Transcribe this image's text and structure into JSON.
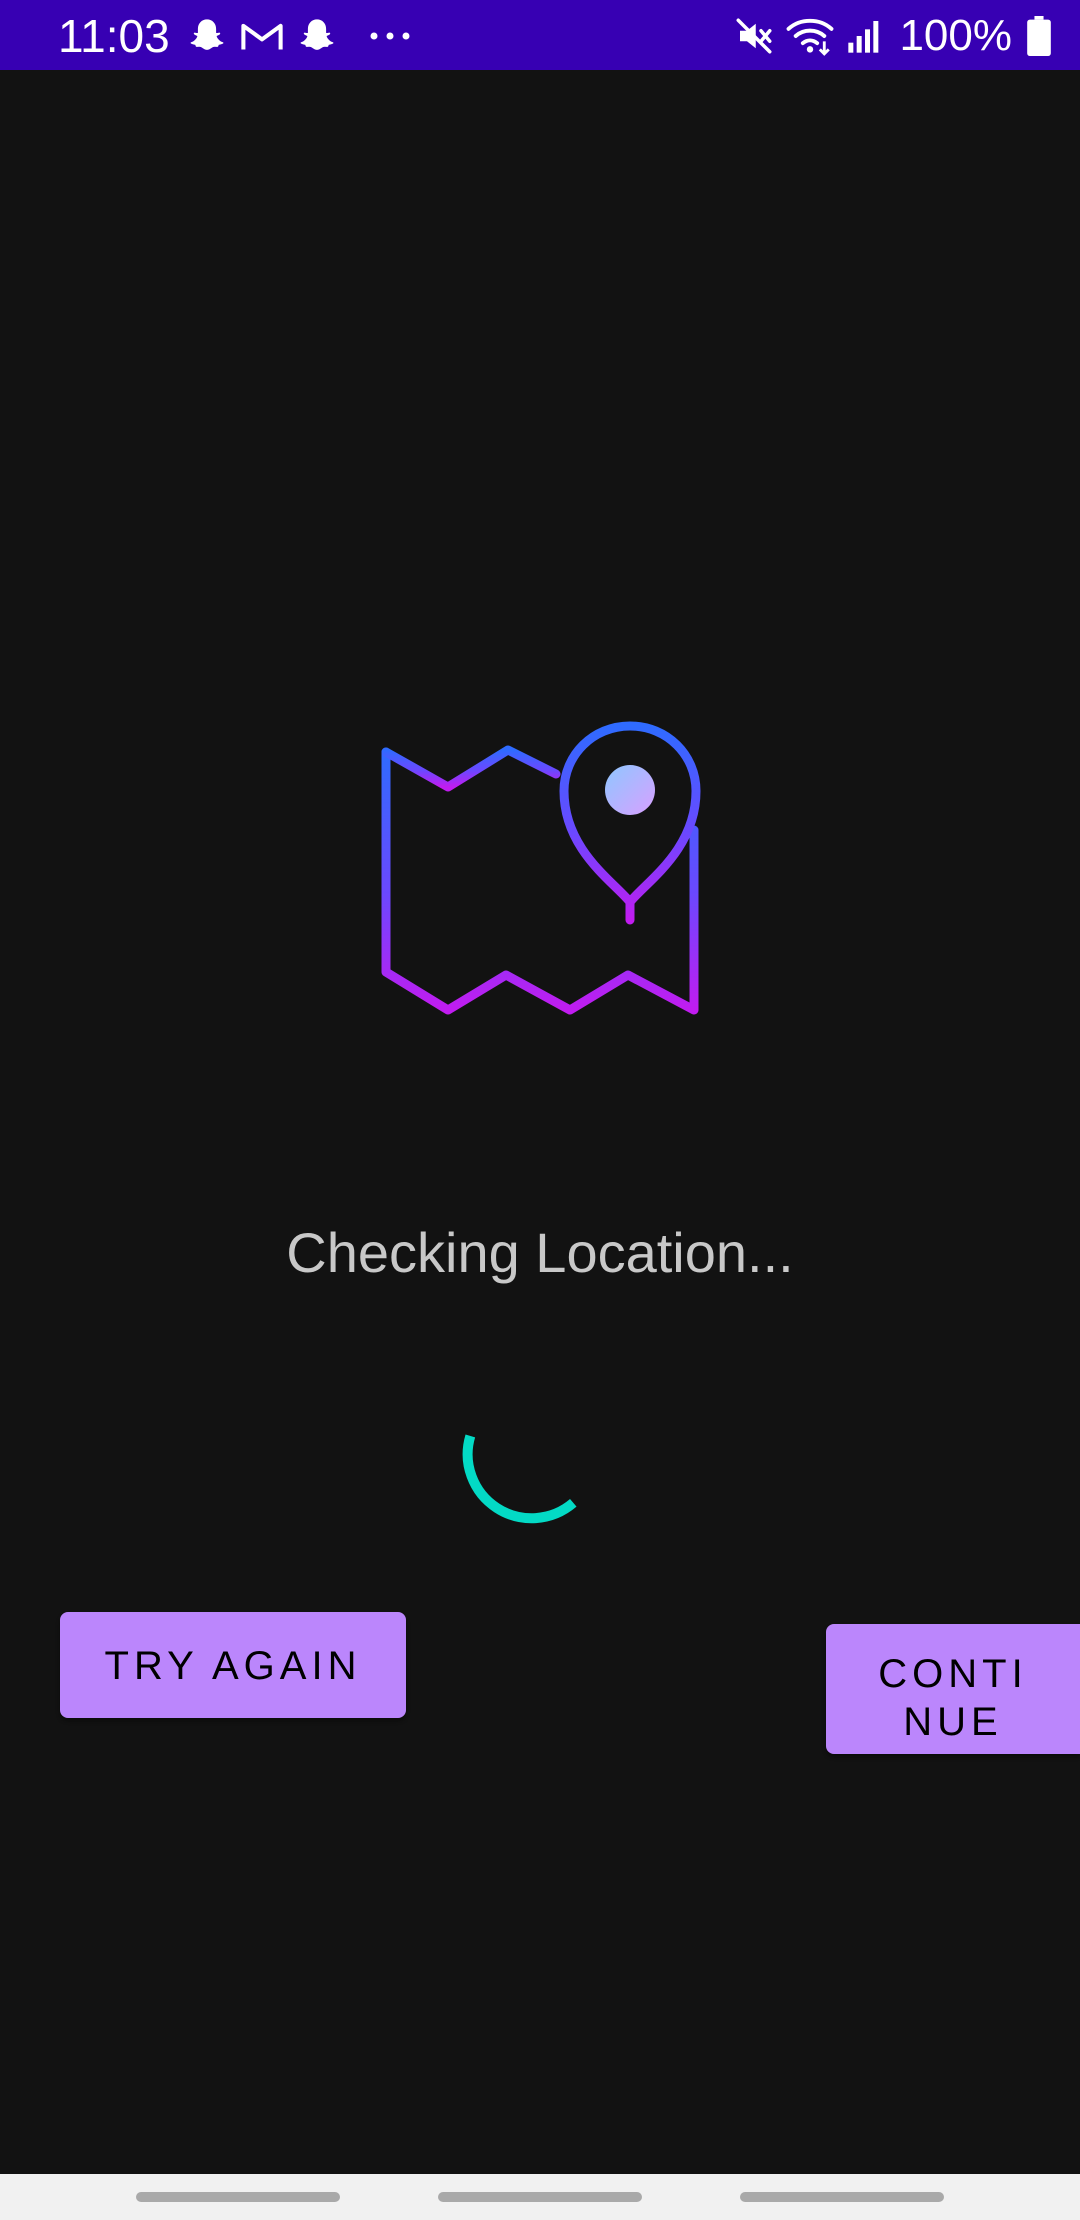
{
  "status_bar": {
    "time": "11:03",
    "left_icons": [
      "snapchat-icon",
      "gmail-icon",
      "snapchat-icon",
      "more-dots-icon"
    ],
    "right_icons": [
      "mute-icon",
      "wifi-icon",
      "signal-icon",
      "battery-icon"
    ],
    "battery_text": "100%",
    "background_color": "#3700b3"
  },
  "main": {
    "illustration": "map-location-pin-icon",
    "status_text": "Checking Location...",
    "spinner_color": "#03dac5",
    "gradient_colors": [
      "#2f6bff",
      "#c11cf0"
    ]
  },
  "buttons": {
    "try_again_label": "TRY AGAIN",
    "continue_label_line1": "CONTI",
    "continue_label_line2": "NUE",
    "button_color": "#bb86fc"
  },
  "nav_bar": {
    "pills": 3
  }
}
